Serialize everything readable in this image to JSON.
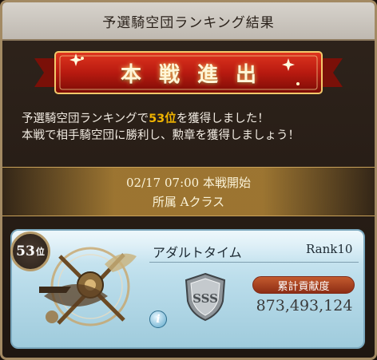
{
  "header": {
    "title": "予選騎空団ランキング結果"
  },
  "banner": {
    "text": [
      "本",
      "戦",
      "進",
      "出"
    ]
  },
  "message": {
    "line1_prefix": "予選騎空団ランキングで",
    "line1_rank": "53位",
    "line1_suffix": "を獲得しました！",
    "line2": "本戦で相手騎空団に勝利し、勲章を獲得しましょう！"
  },
  "info": {
    "start": "02/17 07:00 本戦開始",
    "class": "所属 Aクラス"
  },
  "crew": {
    "rank_number": "53",
    "rank_unit": "位",
    "name": "アダルトタイム",
    "rank_level": "Rank10",
    "contribution_label": "累計貢献度",
    "contribution_value": "873,493,124",
    "class_badge": "SSS",
    "info_icon_glyph": "i"
  },
  "colors": {
    "highlight": "#f0b400",
    "banner_red": "#b81a10",
    "card_blue": "#b9dcea"
  }
}
